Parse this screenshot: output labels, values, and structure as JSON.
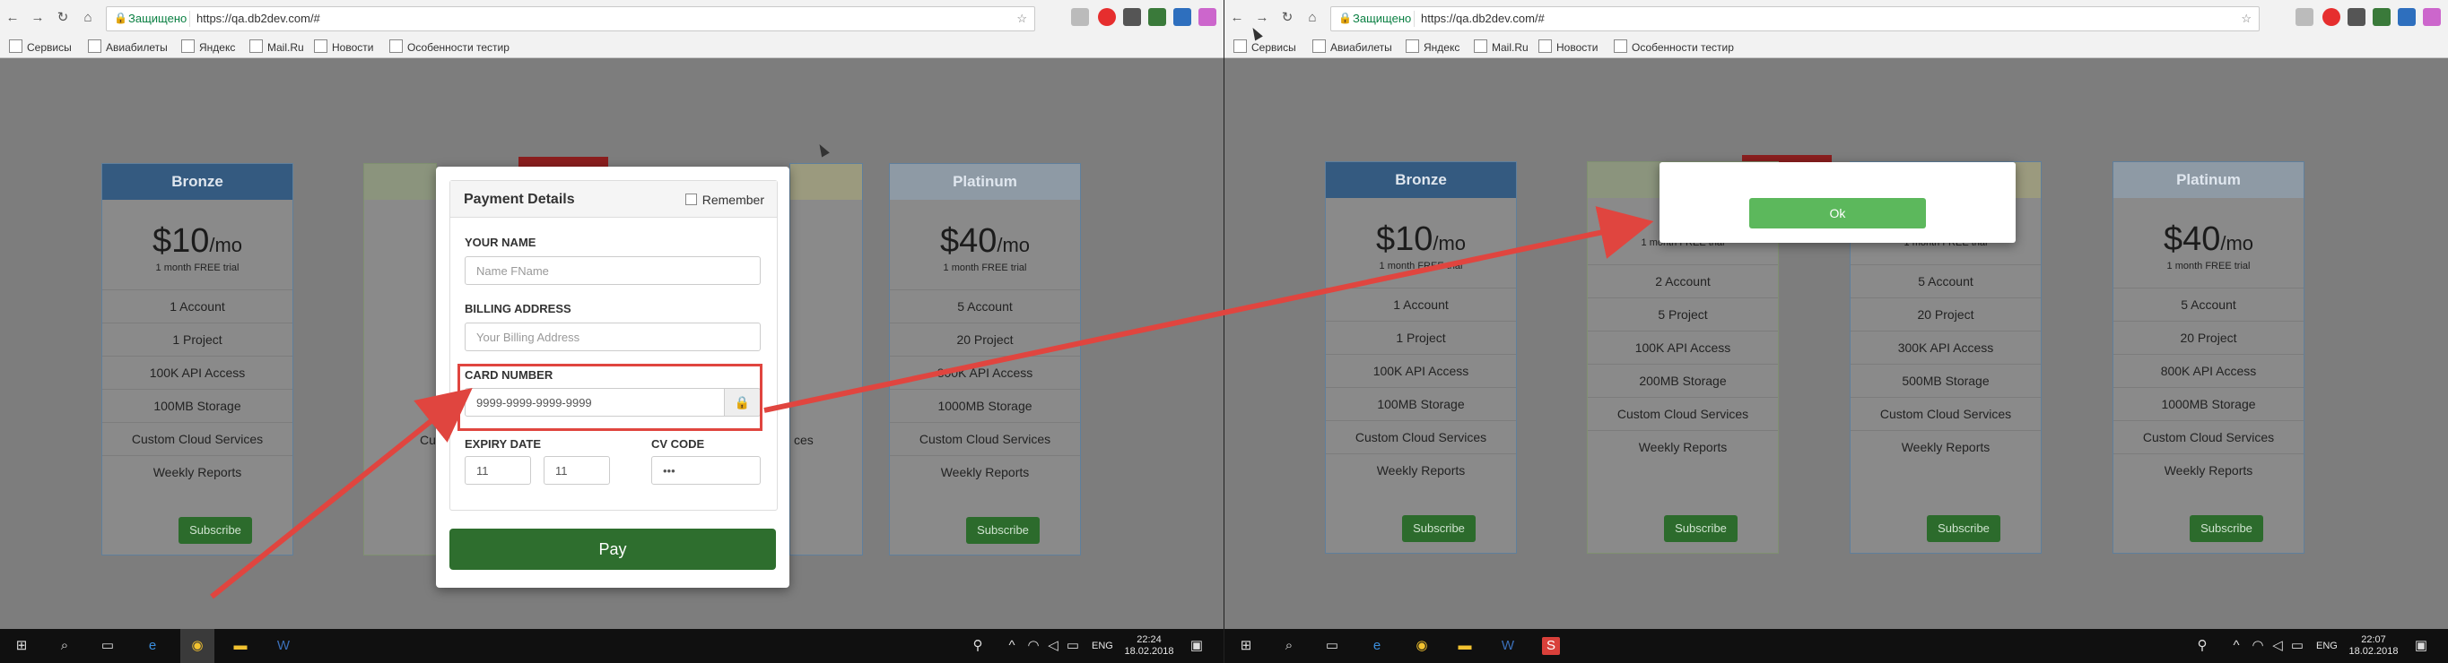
{
  "browser": {
    "secure_label": "Защищено",
    "url": "https://qa.db2dev.com/#",
    "bookmarks": [
      "Сервисы",
      "Авиабилеты",
      "Яндекс",
      "Mail.Ru",
      "Новости",
      "Особенности тестир"
    ]
  },
  "plans_left": [
    {
      "name": "Bronze",
      "price": "$10",
      "per": "/mo",
      "trial": "1 month FREE trial",
      "features": [
        "1 Account",
        "1 Project",
        "100K API Access",
        "100MB Storage",
        "Custom Cloud Services",
        "Weekly Reports"
      ],
      "subscribe": "Subscribe"
    },
    {
      "name": "Platinum",
      "price": "$40",
      "per": "/mo",
      "trial": "1 month FREE trial",
      "features": [
        "5 Account",
        "20 Project",
        "800K API Access",
        "1000MB Storage",
        "Custom Cloud Services",
        "Weekly Reports"
      ],
      "subscribe": "Subscribe"
    }
  ],
  "left_hidden_fragments": {
    "cus": "Cus",
    "services": "ces"
  },
  "payment": {
    "title": "Payment Details",
    "remember": "Remember",
    "name_label": "YOUR NAME",
    "name_placeholder": "Name FName",
    "address_label": "BILLING ADDRESS",
    "address_placeholder": "Your Billing Address",
    "card_label": "CARD NUMBER",
    "card_placeholder": "9999-9999-9999-9999",
    "expiry_label": "EXPIRY DATE",
    "month": "11",
    "year": "11",
    "cvv_label": "CV CODE",
    "cvv": "•••",
    "pay": "Pay"
  },
  "plans_right": [
    {
      "name": "Bronze",
      "price": "$10",
      "per": "/mo",
      "trial": "1 month FREE trial",
      "features": [
        "1 Account",
        "1 Project",
        "100K API Access",
        "100MB Storage",
        "Custom Cloud Services",
        "Weekly Reports"
      ],
      "subscribe": "Subscribe"
    },
    {
      "name": "",
      "price": "",
      "per": "",
      "trial": "1 month FREE trial",
      "features": [
        "2 Account",
        "5 Project",
        "100K API Access",
        "200MB Storage",
        "Custom Cloud Services",
        "Weekly Reports"
      ],
      "subscribe": "Subscribe"
    },
    {
      "name": "",
      "price": "",
      "per": "",
      "trial": "1 month FREE trial",
      "features": [
        "5 Account",
        "20 Project",
        "300K API Access",
        "500MB Storage",
        "Custom Cloud Services",
        "Weekly Reports"
      ],
      "subscribe": "Subscribe"
    },
    {
      "name": "Platinum",
      "price": "$40",
      "per": "/mo",
      "trial": "1 month FREE trial",
      "features": [
        "5 Account",
        "20 Project",
        "800K API Access",
        "1000MB Storage",
        "Custom Cloud Services",
        "Weekly Reports"
      ],
      "subscribe": "Subscribe"
    }
  ],
  "ok_dialog": {
    "ok": "Ok"
  },
  "taskbar_left": {
    "lang": "ENG",
    "time": "22:24",
    "date": "18.02.2018"
  },
  "taskbar_right": {
    "lang": "ENG",
    "time": "22:07",
    "date": "18.02.2018"
  }
}
